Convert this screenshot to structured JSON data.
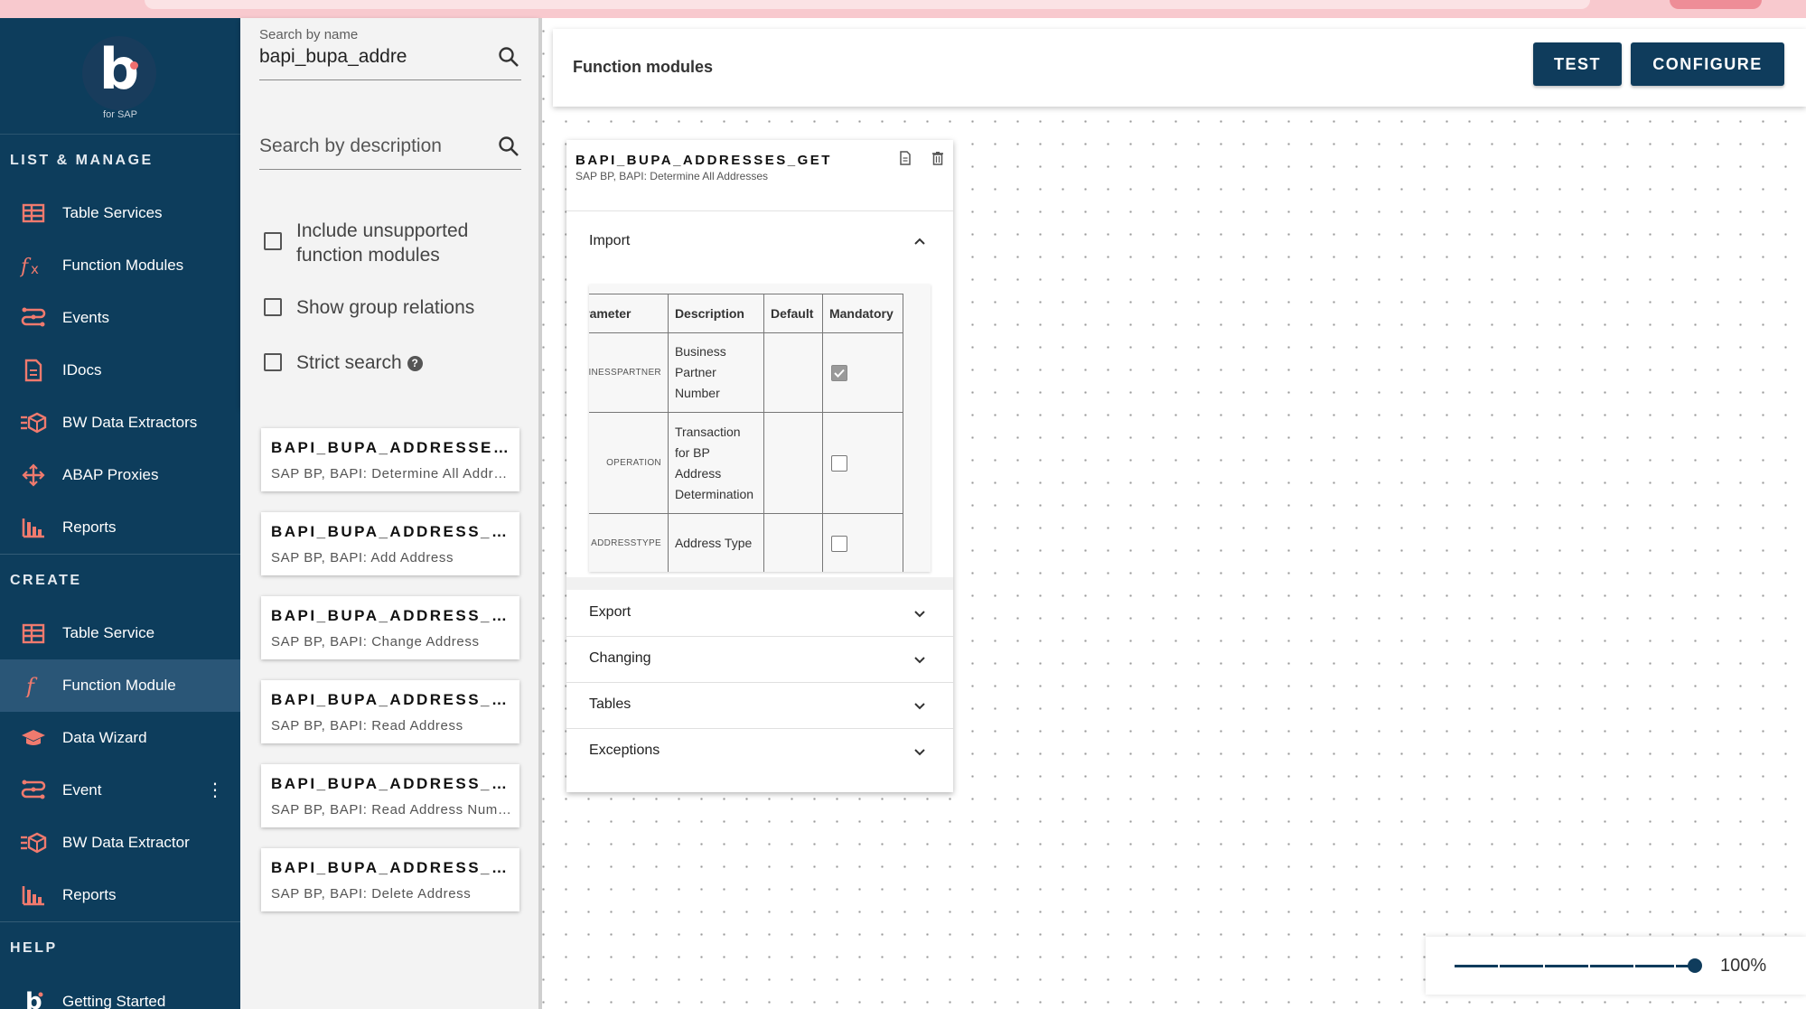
{
  "colors": {
    "sidebar_bg": "#0d3d5c",
    "accent_icon": "#f07a6e",
    "button_bg": "#0f3c5c",
    "topbar": "#f8c9ce"
  },
  "logo": {
    "letter": "b",
    "subtitle": "for SAP"
  },
  "sidebar": {
    "list_manage_title": "LIST & MANAGE",
    "list_manage": [
      {
        "label": "Table Services",
        "icon": "table-icon"
      },
      {
        "label": "Function Modules",
        "icon": "function-fx-icon"
      },
      {
        "label": "Events",
        "icon": "events-icon"
      },
      {
        "label": "IDocs",
        "icon": "document-icon"
      },
      {
        "label": "BW Data Extractors",
        "icon": "cube-extract-icon"
      },
      {
        "label": "ABAP Proxies",
        "icon": "arrows-move-icon"
      },
      {
        "label": "Reports",
        "icon": "bar-chart-icon"
      }
    ],
    "create_title": "CREATE",
    "create": [
      {
        "label": "Table Service",
        "icon": "table-add-icon"
      },
      {
        "label": "Function Module",
        "icon": "function-icon",
        "active": true
      },
      {
        "label": "Data Wizard",
        "icon": "graduation-cap-icon"
      },
      {
        "label": "Event",
        "icon": "events-icon"
      },
      {
        "label": "BW Data Extractor",
        "icon": "cube-extract-icon"
      },
      {
        "label": "Reports",
        "icon": "bar-chart-icon"
      }
    ],
    "help_title": "HELP",
    "help": [
      {
        "label": "Getting Started",
        "icon": "logo-b-icon"
      }
    ]
  },
  "search": {
    "name_label": "Search by name",
    "name_value": "bapi_bupa_addre",
    "description_placeholder": "Search by description",
    "include_unsupported": "Include unsupported function modules",
    "show_group_relations": "Show group relations",
    "strict_search": "Strict search"
  },
  "results": [
    {
      "title": "BAPI_BUPA_ADDRESSES_GET",
      "subtitle": "SAP BP, BAPI: Determine All Addresses"
    },
    {
      "title": "BAPI_BUPA_ADDRESS_ADD",
      "subtitle": "SAP BP, BAPI: Add Address"
    },
    {
      "title": "BAPI_BUPA_ADDRESS_CHANGE",
      "subtitle": "SAP BP, BAPI: Change Address"
    },
    {
      "title": "BAPI_BUPA_ADDRESS_GETDETAIL",
      "subtitle": "SAP BP, BAPI: Read Address"
    },
    {
      "title": "BAPI_BUPA_ADDRESS_GET_NUMBERS",
      "subtitle": "SAP BP, BAPI: Read Address Numbers"
    },
    {
      "title": "BAPI_BUPA_ADDRESS_REMOVE",
      "subtitle": "SAP BP, BAPI: Delete Address"
    }
  ],
  "header": {
    "title": "Function modules",
    "test_label": "TEST",
    "configure_label": "CONFIGURE"
  },
  "function_module": {
    "name": "BAPI_BUPA_ADDRESSES_GET",
    "description": "SAP BP, BAPI: Determine All Addresses",
    "import_label": "Import",
    "columns": [
      "Parameter",
      "Description",
      "Default",
      "Mandatory"
    ],
    "params": [
      {
        "name": "BUSINESSPARTNER",
        "description": "Business Partner Number",
        "default": "",
        "mandatory": true
      },
      {
        "name": "OPERATION",
        "description": "Transaction for BP Address Determination",
        "default": "",
        "mandatory": false
      },
      {
        "name": "ADDRESSTYPE",
        "description": "Address Type",
        "default": "",
        "mandatory": false
      }
    ],
    "sections": [
      "Export",
      "Changing",
      "Tables",
      "Exceptions"
    ]
  },
  "zoom": {
    "label": "100%",
    "level": 100
  }
}
